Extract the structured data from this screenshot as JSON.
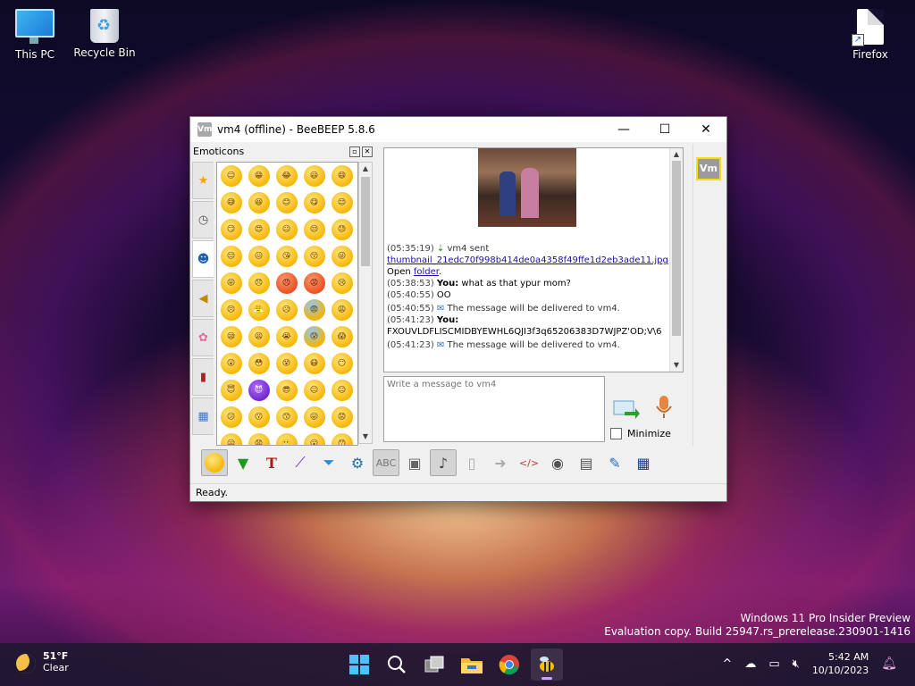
{
  "desktop": {
    "icons": [
      {
        "label": "This PC"
      },
      {
        "label": "Recycle Bin"
      },
      {
        "label": "Firefox"
      }
    ]
  },
  "window": {
    "title": "vm4 (offline) - BeeBEEP 5.8.6",
    "app_icon_text": "Vm",
    "controls": {
      "minimize": "—",
      "maximize": "☐",
      "close": "✕"
    }
  },
  "emoticons_panel": {
    "title": "Emoticons",
    "tabs": [
      "recent-star",
      "clock",
      "faces",
      "horn",
      "flower",
      "people",
      "symbols"
    ],
    "faces": [
      "☺",
      "😁",
      "😂",
      "😃",
      "😄",
      "😅",
      "😆",
      "😊",
      "😋",
      "😌",
      "😏",
      "😍",
      "😐",
      "😒",
      "😓",
      "😔",
      "😖",
      "😘",
      "😚",
      "😜",
      "😝",
      "😞",
      "😠",
      "😡",
      "😢",
      "😣",
      "😤",
      "😥",
      "😨",
      "😩",
      "😪",
      "😫",
      "😭",
      "😰",
      "😱",
      "😲",
      "😳",
      "😵",
      "😷",
      "😶",
      "😇",
      "😈",
      "😎",
      "😐",
      "😑",
      "😕",
      "😗",
      "😙",
      "😛",
      "😟",
      "😦",
      "😧",
      "😬",
      "😮",
      "😯"
    ]
  },
  "chat": {
    "messages": [
      {
        "time": "(05:35:19)",
        "text": " vm4 sent",
        "link": "thumbnail_21edc70f998b414de0a4358f49ffe1d2eb3ade11.jpg",
        "suffix": ".",
        "open_text": "Open ",
        "folder_link": "folder",
        "folder_suffix": "."
      },
      {
        "time": "(05:38:53)",
        "who": "You:",
        "text": " what as that ypur mom?"
      },
      {
        "time": "(05:40:55)",
        "text": "   OO"
      },
      {
        "time": "(05:40:55)",
        "text": " The message will be delivered to vm4."
      },
      {
        "time": "(05:41:23)",
        "who": "You:",
        "text": "FXOUVLDFLISCMIDBYEWHL6QJI3f3q65206383D7WJPZ'OD;V\\6"
      },
      {
        "time": "(05:41:23)",
        "text": " The message will be delivered to vm4."
      }
    ]
  },
  "composer": {
    "placeholder": "Write a message to vm4",
    "minimize_label": "Minimize"
  },
  "sidebar": {
    "avatar_text": "Vm"
  },
  "status": {
    "text": "Ready."
  },
  "watermark": {
    "line1": "Windows 11 Pro Insider Preview",
    "line2": "Evaluation copy. Build 25947.rs_prerelease.230901-1416"
  },
  "taskbar": {
    "weather": {
      "temp": "51°F",
      "condition": "Clear"
    },
    "clock": {
      "time": "5:42 AM",
      "date": "10/10/2023"
    },
    "tray_arrow": "^"
  },
  "colors": {
    "accent": "#4cc2ff",
    "avatar_border": "#f2e300",
    "link": "#1a0dab"
  }
}
